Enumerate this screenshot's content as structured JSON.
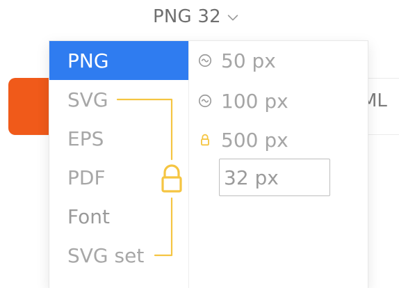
{
  "toolbar": {
    "format_label": "PNG 32",
    "chevron_icon": "chevron-down-icon"
  },
  "background": {
    "right_label_partial": "ML",
    "accent_colors": {
      "orange_button": "#f05a1a",
      "blue_selected": "#2f7cf0",
      "lock_yellow": "#f5c542"
    }
  },
  "dropdown": {
    "formats": [
      {
        "label": "PNG",
        "selected": true
      },
      {
        "label": "SVG",
        "locked": true
      },
      {
        "label": "EPS",
        "locked": true
      },
      {
        "label": "PDF",
        "locked": true
      },
      {
        "label": "Font",
        "locked": true
      },
      {
        "label": "SVG set",
        "locked": true
      }
    ],
    "sizes": [
      {
        "label": "50 px",
        "icon": "infinity-icon"
      },
      {
        "label": "100 px",
        "icon": "infinity-icon"
      },
      {
        "label": "500 px",
        "icon": "lock-icon"
      }
    ],
    "custom_size": {
      "value": "32 px",
      "placeholder": ""
    },
    "lock_icon": "lock-icon"
  }
}
